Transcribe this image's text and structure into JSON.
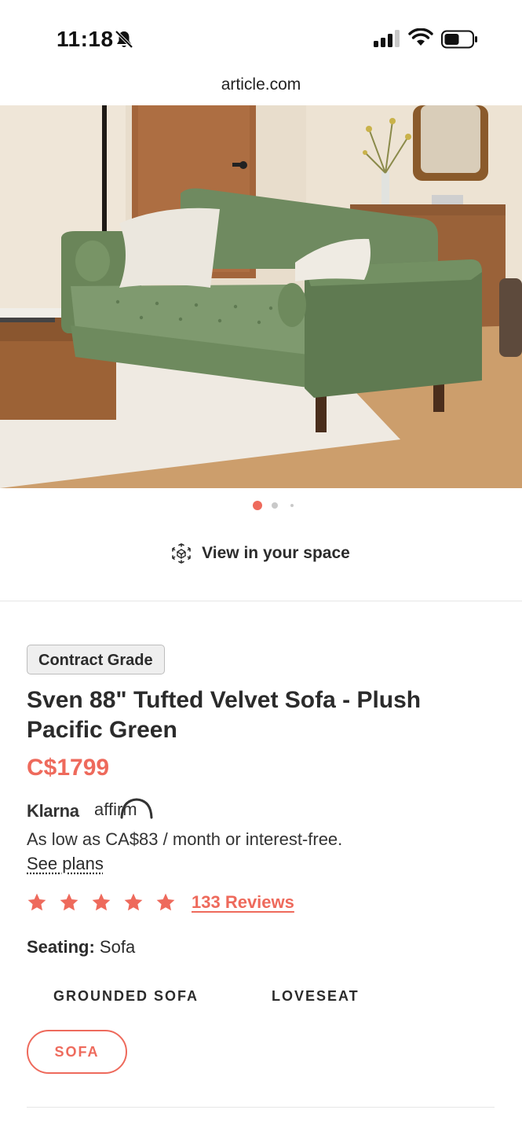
{
  "status_bar": {
    "time": "11:18",
    "icons": [
      "bell-slash-icon",
      "cellular-signal-icon",
      "wifi-icon",
      "battery-icon"
    ]
  },
  "browser": {
    "url": "article.com"
  },
  "gallery": {
    "image": "green-velvet-tufted-sofa-living-room-photo",
    "page_count": 3,
    "active_index": 0
  },
  "ar": {
    "icon": "ar-cube-icon",
    "label": "View in your space"
  },
  "product": {
    "badge": "Contract Grade",
    "title": "Sven 88\" Tufted Velvet Sofa - Plush Pacific Green",
    "price": "C$1799"
  },
  "financing": {
    "klarna": "Klarna",
    "affirm": "affirm",
    "text": "As low as CA$83 / month or interest-free.",
    "link": "See plans"
  },
  "rating": {
    "stars": 5,
    "max": 5,
    "reviews_label": "133 Reviews"
  },
  "seating": {
    "label": "Seating:",
    "value": "Sofa",
    "options": [
      "GROUNDED SOFA",
      "LOVESEAT",
      "SOFA"
    ],
    "selected": "SOFA"
  },
  "colors": {
    "accent": "#ee6a5c",
    "text": "#2b2b2b",
    "sofa_green": "#6f8a60"
  }
}
